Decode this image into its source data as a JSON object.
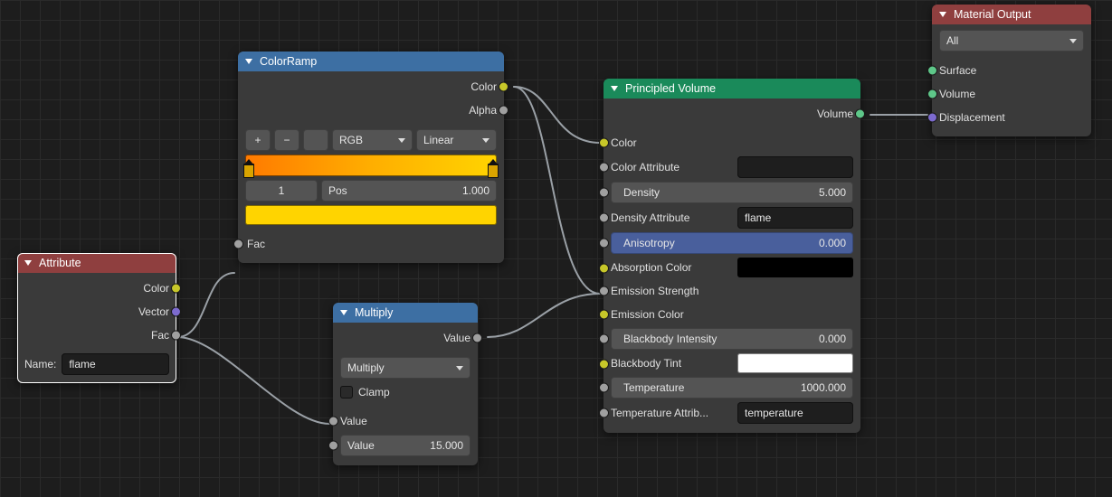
{
  "attribute": {
    "title": "Attribute",
    "color_label": "Color",
    "vector_label": "Vector",
    "fac_label": "Fac",
    "name_label": "Name:",
    "name_value": "flame"
  },
  "colorramp": {
    "title": "ColorRamp",
    "color_label": "Color",
    "alpha_label": "Alpha",
    "fac_label": "Fac",
    "mode": "RGB",
    "interp": "Linear",
    "stop_index": "1",
    "pos_label": "Pos",
    "pos_value": "1.000",
    "preview_hex": "#ffd400"
  },
  "multiply": {
    "title": "Multiply",
    "value_out": "Value",
    "op": "Multiply",
    "clamp_label": "Clamp",
    "inA_label": "Value",
    "inB_label": "Value",
    "inB_value": "15.000"
  },
  "volume": {
    "title": "Principled Volume",
    "volume_out": "Volume",
    "color_label": "Color",
    "color_attr_label": "Color Attribute",
    "color_attr_value": "",
    "density_label": "Density",
    "density_value": "5.000",
    "density_attr_label": "Density Attribute",
    "density_attr_value": "flame",
    "aniso_label": "Anisotropy",
    "aniso_value": "0.000",
    "abscolor_label": "Absorption Color",
    "abscolor_hex": "#000000",
    "emit_str_label": "Emission Strength",
    "emit_col_label": "Emission Color",
    "bb_int_label": "Blackbody Intensity",
    "bb_int_value": "0.000",
    "bb_tint_label": "Blackbody Tint",
    "bb_tint_hex": "#ffffff",
    "temp_label": "Temperature",
    "temp_value": "1000.000",
    "temp_attr_label": "Temperature Attrib...",
    "temp_attr_value": "temperature"
  },
  "output": {
    "title": "Material Output",
    "target": "All",
    "surface": "Surface",
    "volume": "Volume",
    "disp": "Displacement"
  }
}
